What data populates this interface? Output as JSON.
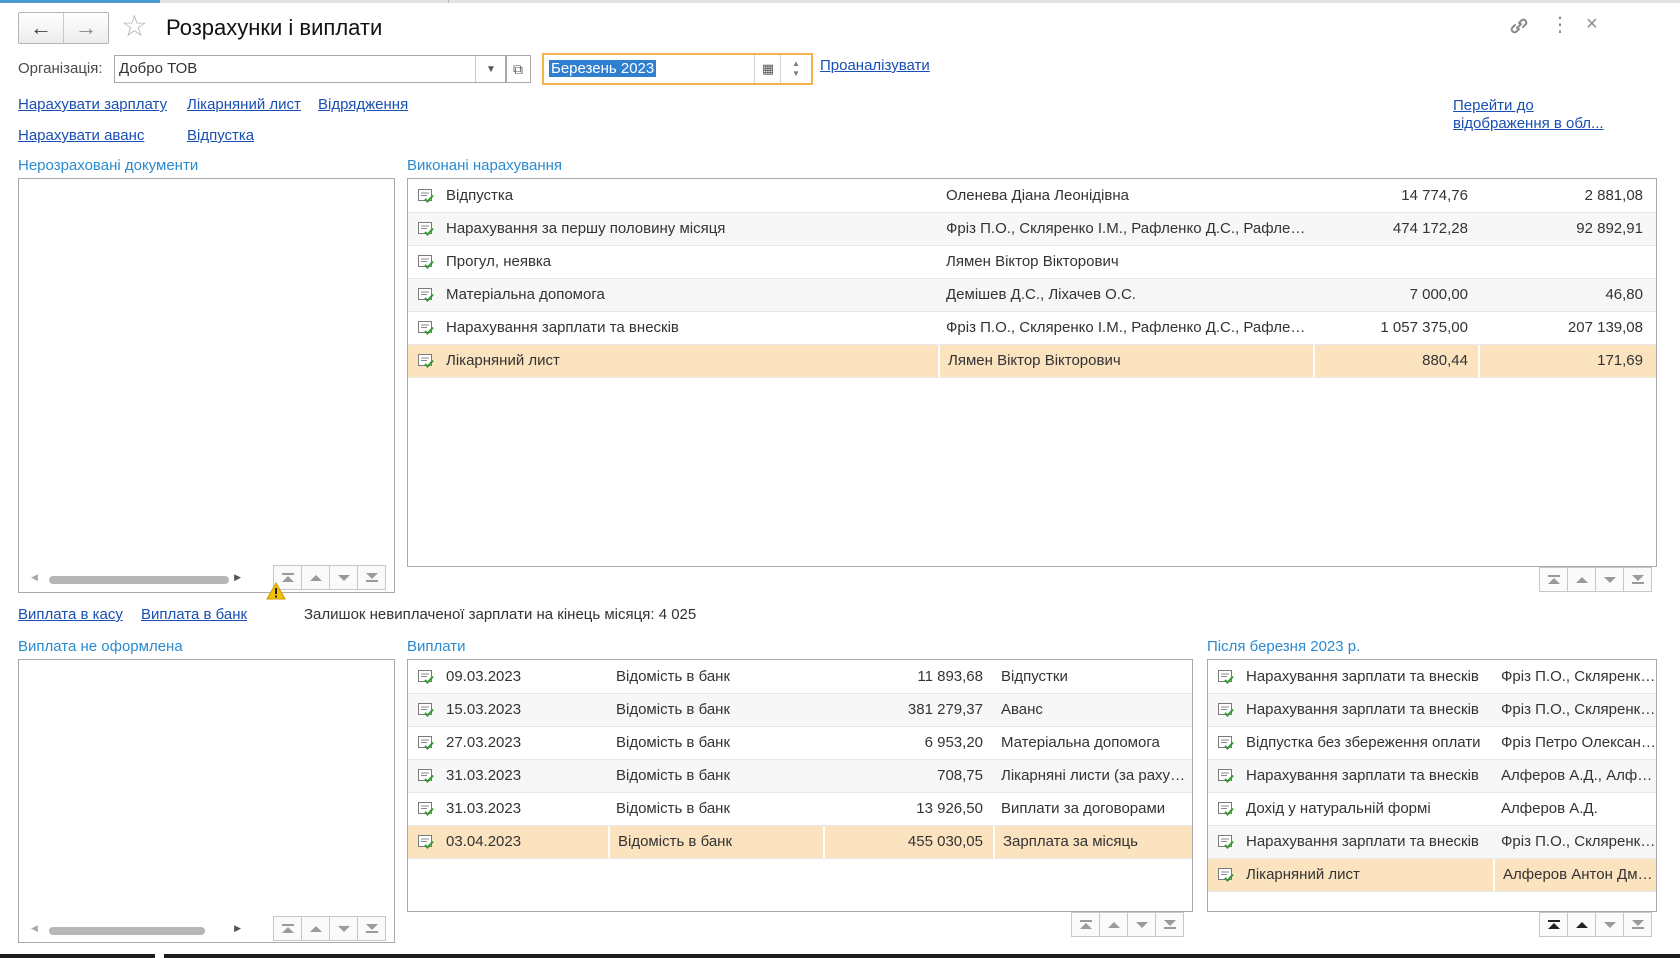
{
  "window": {
    "title": "Розрахунки і виплати"
  },
  "header": {
    "link_icon": "link-icon",
    "more_icon": "more-vertical-icon",
    "close_icon": "close-icon"
  },
  "filters": {
    "org_label": "Організація:",
    "org_value": "Добро ТОВ",
    "period_value": "Березень 2023",
    "analyze_link": "Проаналізувати"
  },
  "actions": {
    "row1": [
      "Нарахувати зарплату",
      "Лікарняний лист",
      "Відрядження"
    ],
    "row2": [
      "Нарахувати аванс",
      "Відпустка"
    ],
    "goto_link_line1": "Перейти до",
    "goto_link_line2": "відображення в обл..."
  },
  "sections": {
    "unprocessed": "Нерозраховані документи",
    "accruals": "Виконані нарахування",
    "payment_not_issued": "Виплата не оформлена",
    "payments": "Виплати",
    "after": "Після березня 2023 р."
  },
  "accruals": [
    {
      "doc": "Відпустка",
      "employees": "Оленева Діана Леонідівна",
      "amount": "14 774,76",
      "tax": "2 881,08"
    },
    {
      "doc": "Нарахування за першу половину місяця",
      "employees": "Фріз П.О., Скляренко І.М., Рафленко Д.С., Рафленко Д.С.",
      "amount": "474 172,28",
      "tax": "92 892,91"
    },
    {
      "doc": "Прогул, неявка",
      "employees": "Лямен Віктор Вікторович",
      "amount": "",
      "tax": ""
    },
    {
      "doc": "Матеріальна допомога",
      "employees": "Демішев Д.С., Ліхачев О.С.",
      "amount": "7 000,00",
      "tax": "46,80"
    },
    {
      "doc": "Нарахування зарплати та внесків",
      "employees": "Фріз П.О., Скляренко І.М., Рафленко Д.С., Рафленко Д.С.",
      "amount": "1 057 375,00",
      "tax": "207 139,08"
    },
    {
      "doc": "Лікарняний лист",
      "employees": "Лямен Віктор Вікторович",
      "amount": "880,44",
      "tax": "171,69"
    }
  ],
  "payment_links": [
    "Виплата в касу",
    "Виплата в банк"
  ],
  "remainder_text": "Залишок невиплаченої зарплати на кінець місяця: 4 025",
  "payments": [
    {
      "date": "09.03.2023",
      "kind": "Відомість в банк",
      "amount": "11 893,68",
      "purpose": "Відпустки"
    },
    {
      "date": "15.03.2023",
      "kind": "Відомість в банк",
      "amount": "381 279,37",
      "purpose": "Аванс"
    },
    {
      "date": "27.03.2023",
      "kind": "Відомість в банк",
      "amount": "6 953,20",
      "purpose": "Матеріальна допомога"
    },
    {
      "date": "31.03.2023",
      "kind": "Відомість в банк",
      "amount": "708,75",
      "purpose": "Лікарняні листи (за рахунок роботодавця)"
    },
    {
      "date": "31.03.2023",
      "kind": "Відомість в банк",
      "amount": "13 926,50",
      "purpose": "Виплати за договорами"
    },
    {
      "date": "03.04.2023",
      "kind": "Відомість в банк",
      "amount": "455 030,05",
      "purpose": "Зарплата за місяць"
    }
  ],
  "after_docs": [
    {
      "doc": "Нарахування зарплати та внесків",
      "employees": "Фріз П.О., Скляренко І.М."
    },
    {
      "doc": "Нарахування зарплати та внесків",
      "employees": "Фріз П.О., Скляренко І.М."
    },
    {
      "doc": "Відпустка без збереження оплати",
      "employees": "Фріз Петро Олександрович"
    },
    {
      "doc": "Нарахування зарплати та внесків",
      "employees": "Алферов А.Д., Алферов А.Д."
    },
    {
      "doc": "Дохід у натуральній формі",
      "employees": "Алферов А.Д."
    },
    {
      "doc": "Нарахування зарплати та внесків",
      "employees": "Фріз П.О., Скляренко І.М."
    },
    {
      "doc": "Лікарняний лист",
      "employees": "Алферов Антон Дмитрович"
    }
  ],
  "colors": {
    "accent_link": "#1a4fb3",
    "section_label": "#2a8bcf",
    "selected_row": "#fbe3c0",
    "focus_border": "#f5b24c"
  }
}
